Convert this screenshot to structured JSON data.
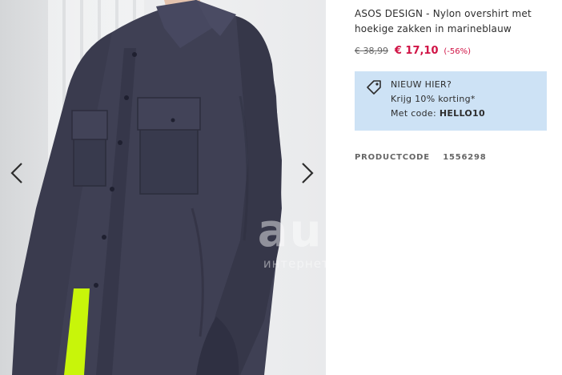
{
  "product": {
    "title": "ASOS DESIGN - Nylon overshirt met hoekige zakken in marineblauw",
    "price_old": "€ 38,99",
    "price_new": "€ 17,10",
    "price_discount": "(-56%)",
    "productcode_label": "PRODUCTCODE",
    "productcode_value": "1556298"
  },
  "promo": {
    "line1": "NIEUW HIER?",
    "line2": "Krijg 10% korting*",
    "line3_prefix": "Met code:",
    "code": "HELLO10",
    "icon": "price-tag-icon"
  },
  "gallery": {
    "prev_icon": "chevron-left-icon",
    "next_icon": "chevron-right-icon",
    "shirt_color": "#3f4054",
    "accent_color": "#c8f50a"
  },
  "watermark": {
    "big": "au.ru",
    "small": "интернет-аукцион"
  },
  "colors": {
    "sale": "#d01345",
    "promo_bg": "#cde2f5",
    "text": "#2d2d2d"
  }
}
